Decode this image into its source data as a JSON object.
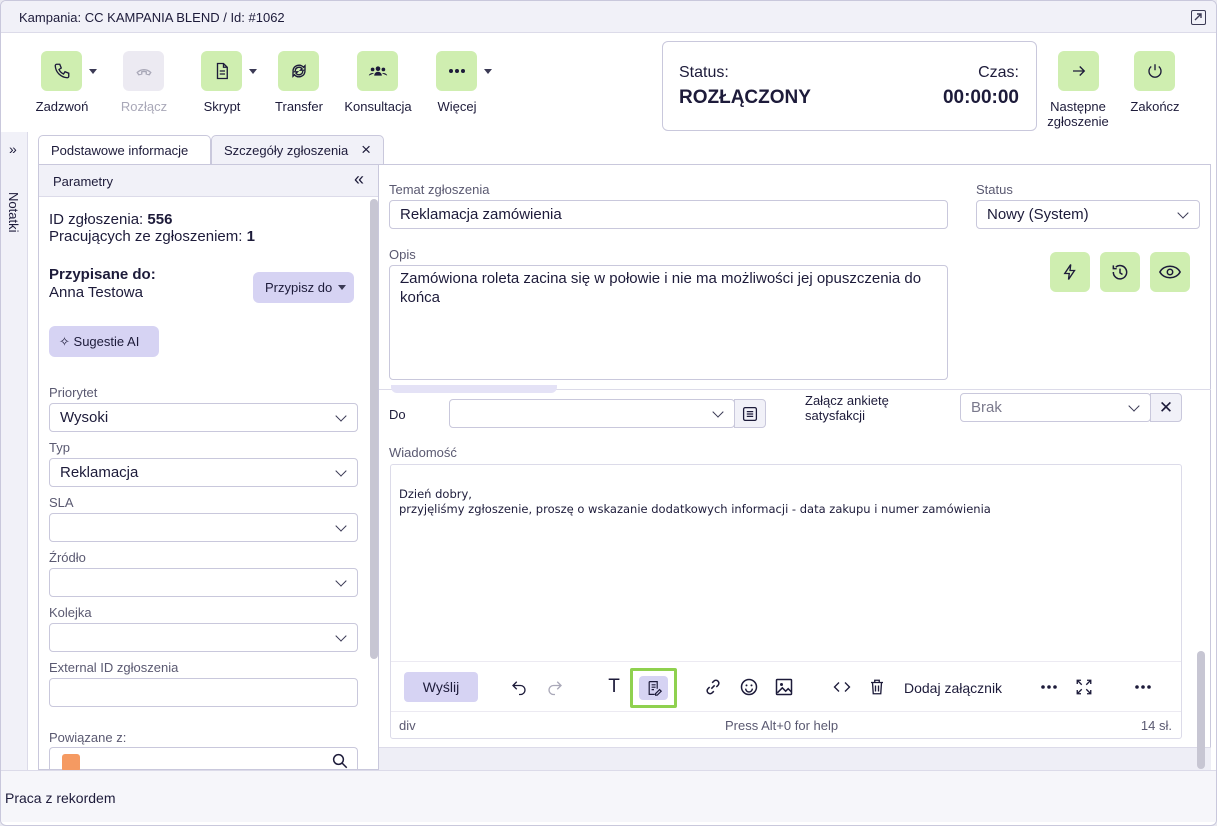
{
  "window": {
    "title": "Kampania: CC KAMPANIA BLEND / Id: #1062"
  },
  "toolbar": {
    "call": "Zadzwoń",
    "disconnect": "Rozłącz",
    "script": "Skrypt",
    "transfer": "Transfer",
    "consultation": "Konsultacja",
    "more": "Więcej",
    "next_line1": "Następne",
    "next_line2": "zgłoszenie",
    "finish": "Zakończ"
  },
  "status": {
    "status_label": "Status:",
    "status_value": "ROZŁĄCZONY",
    "time_label": "Czas:",
    "time_value": "00:00:00"
  },
  "side_tab": "Notatki",
  "tabs": [
    {
      "label": "Podstawowe informacje"
    },
    {
      "label": "Szczegóły zgłoszenia"
    }
  ],
  "params": {
    "title": "Parametry",
    "id_label": "ID zgłoszenia:",
    "id_value": "556",
    "working_label": "Pracujących ze zgłoszeniem:",
    "working_value": "1",
    "assigned_label": "Przypisane do:",
    "assigned_value": "Anna Testowa",
    "assign_button": "Przypisz do",
    "ai_button": "Sugestie AI",
    "priority_label": "Priorytet",
    "priority_value": "Wysoki",
    "type_label": "Typ",
    "type_value": "Reklamacja",
    "sla_label": "SLA",
    "sla_value": "",
    "source_label": "Źródło",
    "source_value": "",
    "queue_label": "Kolejka",
    "queue_value": "",
    "external_id_label": "External ID zgłoszenia",
    "external_id_value": "",
    "related_label": "Powiązane z:"
  },
  "ticket": {
    "subject_label": "Temat zgłoszenia",
    "subject_value": "Reklamacja zamówienia",
    "status_label": "Status",
    "status_value": "Nowy (System)",
    "desc_label": "Opis",
    "desc_value": "Zamówiona roleta zacina się w połowie i nie ma możliwości jej opuszczenia do końca"
  },
  "message": {
    "to_label": "Do",
    "to_value": "",
    "survey_label_line1": "Załącz ankietę",
    "survey_label_line2": "satysfakcji",
    "survey_value": "Brak",
    "label": "Wiadomość",
    "body_line1": "Dzień dobry,",
    "body_line2": "przyjęliśmy zgłoszenie, proszę o wskazanie dodatkowych informacji -  data zakupu i numer zamówienia",
    "send_button": "Wyślij",
    "attach_label": "Dodaj załącznik",
    "footer_path": "div",
    "footer_help": "Press Alt+0 for help",
    "footer_words": "14 sł."
  },
  "bottom": {
    "label": "Praca z rekordem"
  },
  "colors": {
    "accent_green": "#cfeeb0",
    "accent_purple": "#d6d3f3",
    "highlight": "#8fd14f"
  }
}
